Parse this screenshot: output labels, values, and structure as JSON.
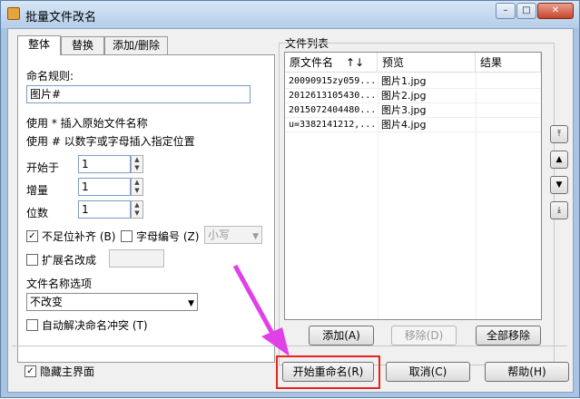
{
  "window": {
    "title": "批量文件改名"
  },
  "tabs": [
    {
      "label": "整体"
    },
    {
      "label": "替换"
    },
    {
      "label": "添加/删除"
    }
  ],
  "rules": {
    "naming_label": "命名规则:",
    "naming_value": "图片#",
    "hint1": "使用 * 插入原始文件名称",
    "hint2": "使用 # 以数字或字母插入指定位置",
    "start_label": "开始于",
    "start_value": "1",
    "step_label": "增量",
    "step_value": "1",
    "digits_label": "位数",
    "digits_value": "1",
    "pad_label": "不足位补齐 (B)",
    "letter_label": "字母编号 (Z)",
    "case_value": "小写",
    "ext_label": "扩展名改成",
    "filename_opt_label": "文件名称选项",
    "filename_opt_value": "不改变",
    "auto_resolve_label": "自动解决命名冲突 (T)"
  },
  "filelist": {
    "group_label": "文件列表",
    "columns": [
      "原文件名",
      "↑↓",
      "预览",
      "结果"
    ],
    "rows": [
      {
        "orig": "20090915zy059...",
        "preview": "图片1.jpg",
        "result": ""
      },
      {
        "orig": "2012613105430...",
        "preview": "图片2.jpg",
        "result": ""
      },
      {
        "orig": "2015072404480...",
        "preview": "图片3.jpg",
        "result": ""
      },
      {
        "orig": "u=3382141212,...",
        "preview": "图片4.jpg",
        "result": ""
      }
    ],
    "add_btn": "添加(A)",
    "remove_btn": "移除(D)",
    "remove_all_btn": "全部移除"
  },
  "footer": {
    "hide_main_label": "隐藏主界面",
    "start_btn": "开始重命名(R)",
    "cancel_btn": "取消(C)",
    "help_btn": "帮助(H)"
  },
  "colors": {
    "highlight": "#e8231f",
    "arrow": "#e040e8"
  }
}
